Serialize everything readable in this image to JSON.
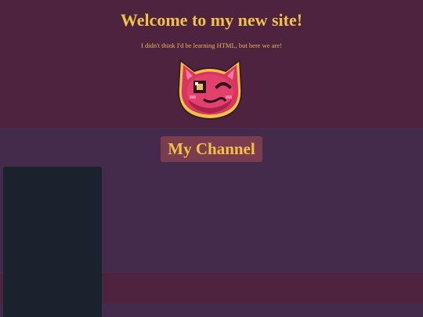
{
  "header": {
    "title": "Welcome to my new site!",
    "subtitle": "I didn't think I'd be learning HTML, but here we are!",
    "mascot_icon": "pink-cat-winking-icon"
  },
  "main": {
    "channel_button_label": "My Channel"
  },
  "colors": {
    "page_background": "#442a4b",
    "header_background": "#4d2340",
    "accent_text": "#f3c245",
    "button_background": "#7a3c4f",
    "side_panel_background": "#1a222d"
  }
}
